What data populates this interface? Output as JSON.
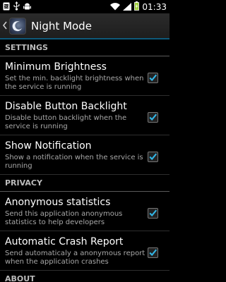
{
  "status_bar": {
    "time": "01:33",
    "left_icons": [
      "sim-card-icon",
      "usb-icon",
      "android-icon"
    ],
    "right_icons": [
      "wifi-icon",
      "signal-icon",
      "battery-icon"
    ]
  },
  "action_bar": {
    "title": "Night Mode"
  },
  "sections": [
    {
      "header": "SETTINGS",
      "items": [
        {
          "title": "Minimum Brightness",
          "summary": "Set the min. backlight brightness when the service is running",
          "checked": true
        },
        {
          "title": "Disable Button Backlight",
          "summary": "Disable button backlight when the service is running",
          "checked": true
        },
        {
          "title": "Show Notification",
          "summary": "Show a notification when the service is running",
          "checked": true
        }
      ]
    },
    {
      "header": "PRIVACY",
      "items": [
        {
          "title": "Anonymous statistics",
          "summary": "Send this application anonymous statistics to help developers",
          "checked": true
        },
        {
          "title": "Automatic Crash Report",
          "summary": "Send automaticaly a anonymous report when the application crashes",
          "checked": true
        }
      ]
    },
    {
      "header": "ABOUT",
      "items": []
    }
  ],
  "colors": {
    "accent": "#33b5e5",
    "background": "#000000",
    "actionbar_divider": "#0e5a7b"
  }
}
